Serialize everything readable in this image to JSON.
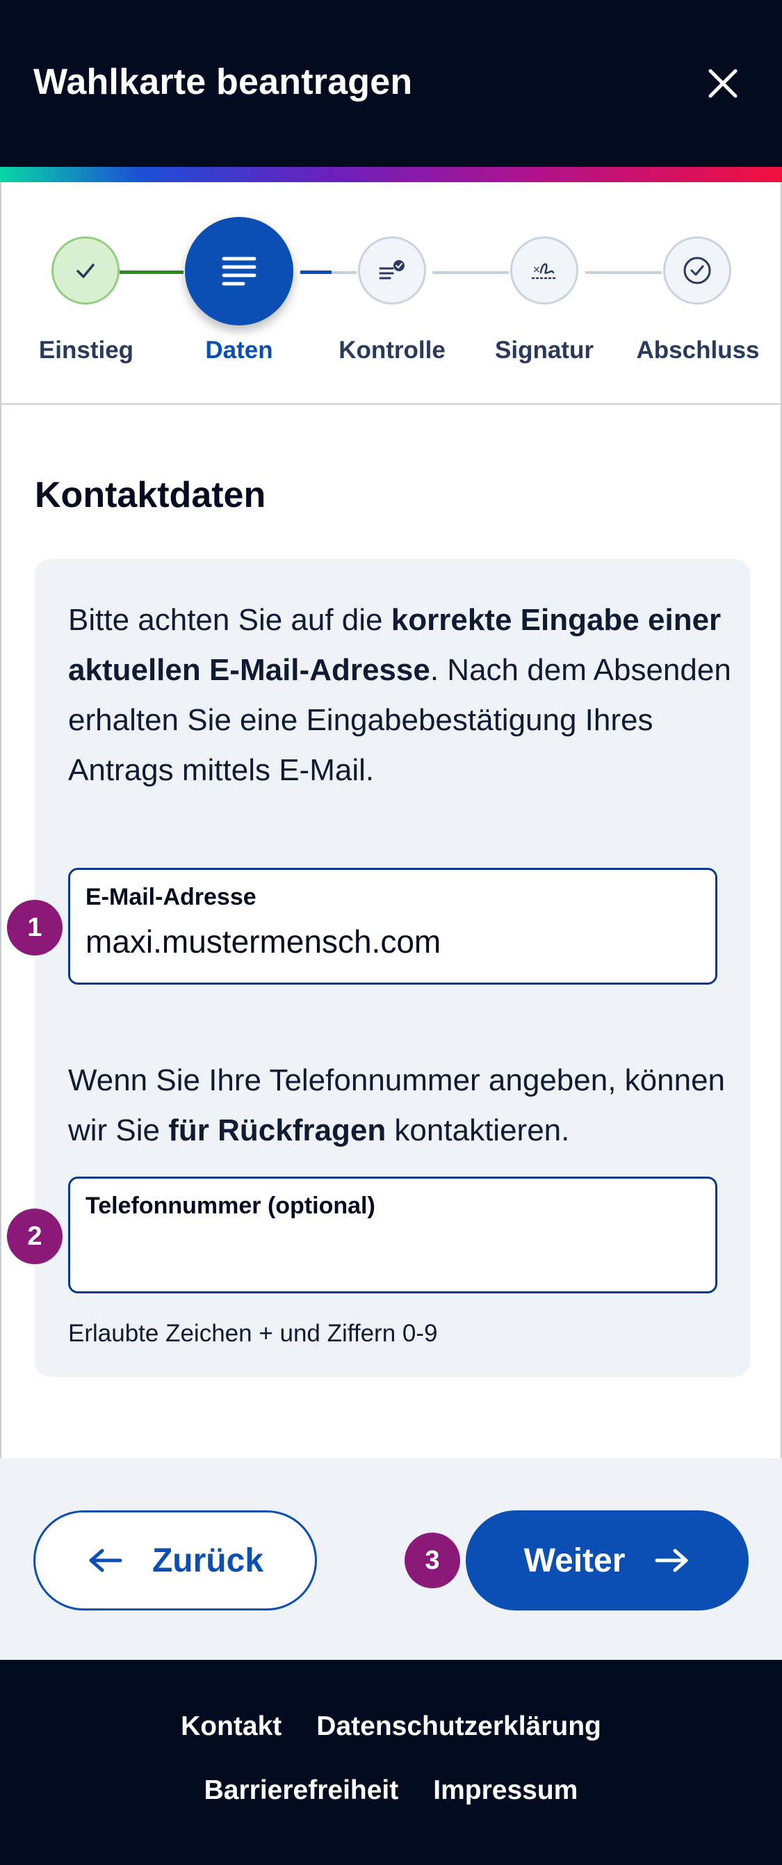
{
  "header": {
    "title": "Wahlkarte beantragen",
    "close_icon": "close-icon"
  },
  "steps": [
    {
      "label": "Einstieg",
      "state": "done",
      "icon": "checkmark-icon"
    },
    {
      "label": "Daten",
      "state": "current",
      "icon": "lines-icon"
    },
    {
      "label": "Kontrolle",
      "state": "todo",
      "icon": "list-check-icon"
    },
    {
      "label": "Signatur",
      "state": "todo",
      "icon": "signature-icon"
    },
    {
      "label": "Abschluss",
      "state": "todo",
      "icon": "check-circle-icon"
    }
  ],
  "main": {
    "section_title": "Kontaktdaten",
    "intro_pre": "Bitte achten Sie auf die ",
    "intro_bold": "korrekte Eingabe einer aktuellen E-Mail-Adresse",
    "intro_post": ". Nach dem Absenden erhalten Sie eine Eingabebestätigung Ihres Antrags mittels E-Mail.",
    "email": {
      "label": "E-Mail-Adresse",
      "value": "maxi.mustermensch.com"
    },
    "hint_pre": "Wenn Sie Ihre Telefonnummer angeben, können wir Sie ",
    "hint_bold": "für Rückfragen",
    "hint_post": " kontaktieren.",
    "phone": {
      "label": "Telefonnummer (optional)",
      "value": ""
    },
    "phone_helper": "Erlaubte Zeichen + und Ziffern 0-9"
  },
  "badges": [
    "1",
    "2",
    "3"
  ],
  "navigation": {
    "back_label": "Zurück",
    "next_label": "Weiter"
  },
  "footer": {
    "links_row1": [
      "Kontakt",
      "Datenschutzerklärung"
    ],
    "links_row2": [
      "Barrierefreiheit",
      "Impressum"
    ]
  },
  "colors": {
    "primary": "#0b4fb5",
    "header_bg": "#020b1f",
    "badge": "#8a1978",
    "done": "#2e8b1f",
    "panel_bg": "#eff2f7"
  }
}
